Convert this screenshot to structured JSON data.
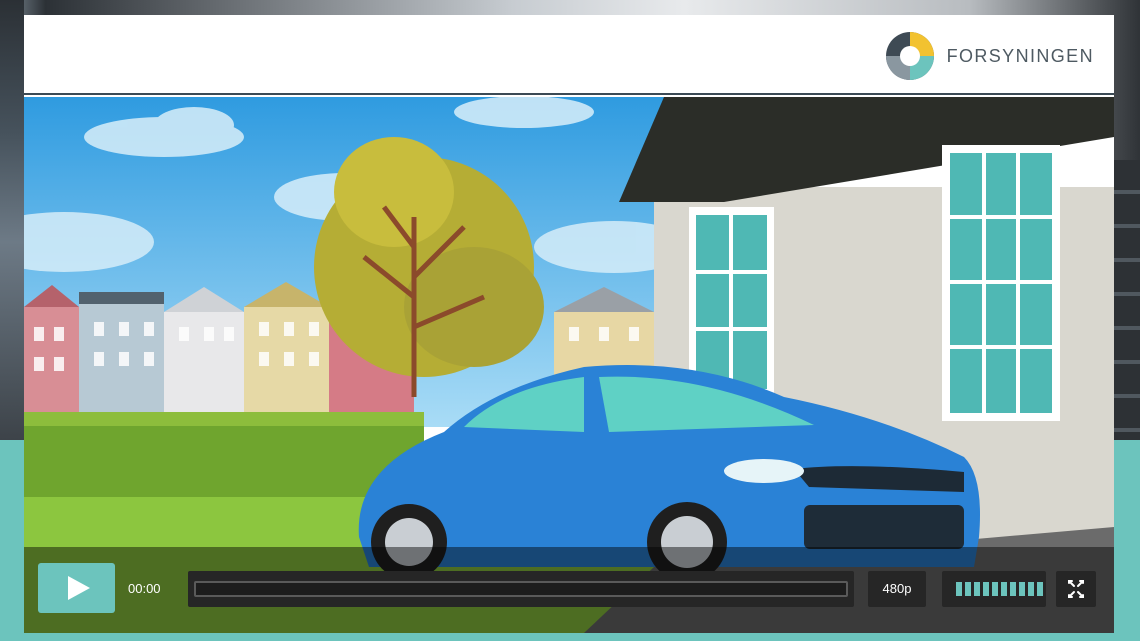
{
  "brand": {
    "name": "FORSYNINGEN",
    "colors": {
      "accent": "#6cc4bd",
      "logo_gray": "#4e5a62",
      "logo_yellow": "#f2c230",
      "logo_dark": "#3e4a54"
    }
  },
  "video": {
    "scene_description_icon": "animated-car-scene"
  },
  "controls": {
    "play_icon": "play-icon",
    "time": "00:00",
    "progress": 0,
    "quality": "480p",
    "volume_level": 1.0,
    "volume_bars": 10,
    "fullscreen_icon": "fullscreen-icon"
  }
}
